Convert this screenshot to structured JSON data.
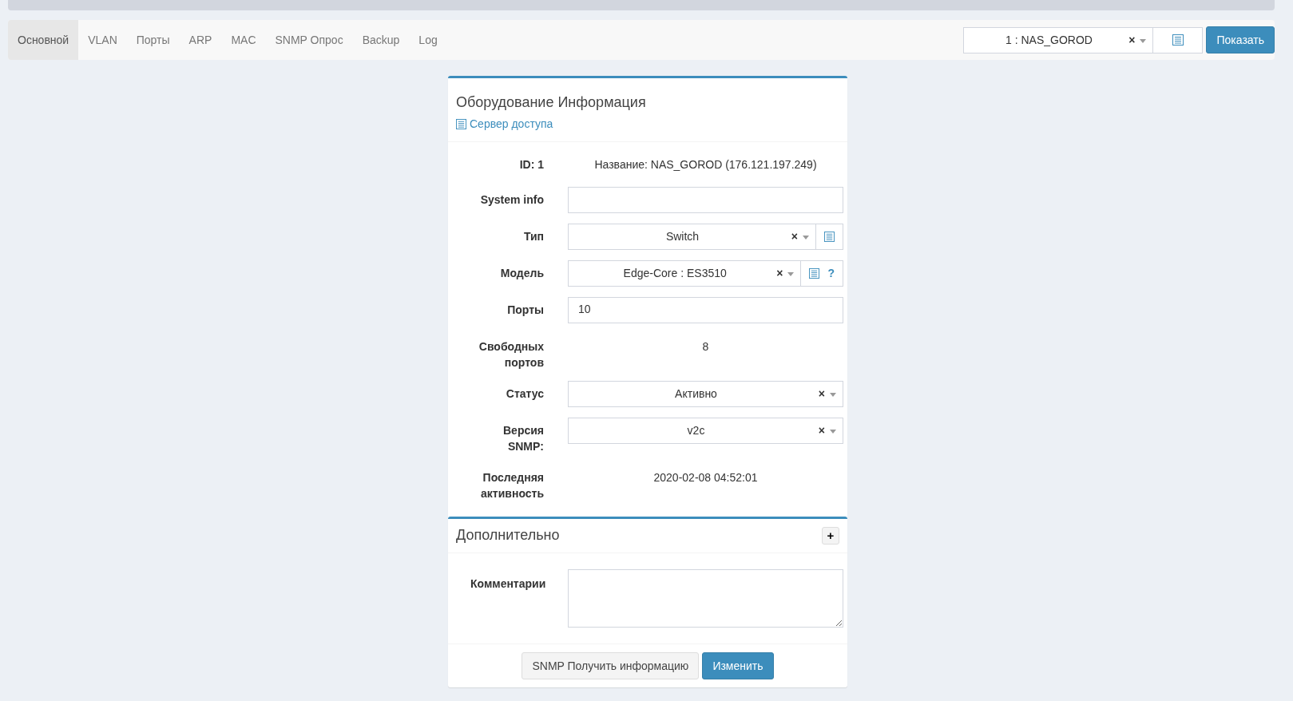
{
  "tabs": [
    {
      "label": "Основной",
      "selected": true
    },
    {
      "label": "VLAN",
      "selected": false
    },
    {
      "label": "Порты",
      "selected": false
    },
    {
      "label": "ARP",
      "selected": false
    },
    {
      "label": "MAC",
      "selected": false
    },
    {
      "label": "SNMP Опрос",
      "selected": false
    },
    {
      "label": "Backup",
      "selected": false
    },
    {
      "label": "Log",
      "selected": false
    }
  ],
  "device_picker": {
    "value": "1 : NAS_GOROD",
    "clear": "×",
    "button": "Показать"
  },
  "info_panel": {
    "title": "Оборудование Информация",
    "link": "Сервер доступа",
    "rows": [
      {
        "kind": "text",
        "label": "ID: 1",
        "value": "Название: NAS_GOROD (176.121.197.249)"
      },
      {
        "kind": "input",
        "label": "System info"
      },
      {
        "kind": "select",
        "label": "Тип",
        "value": "Switch",
        "clear": "×",
        "list_button": true
      },
      {
        "kind": "select",
        "label": "Модель",
        "value": "Edge-Core : ES3510",
        "clear": "×",
        "list_button": true,
        "help": "?"
      },
      {
        "kind": "input",
        "label": "Порты",
        "value": "10"
      },
      {
        "kind": "text",
        "label": "Свободных портов",
        "value": "8"
      },
      {
        "kind": "select",
        "label": "Статус",
        "value": "Активно",
        "clear": "×",
        "list_button": false
      },
      {
        "kind": "select",
        "label": "Версия SNMP:",
        "value": "v2c",
        "clear": "×",
        "list_button": false
      },
      {
        "kind": "text",
        "label": "Последняя активность",
        "value": "2020-02-08 04:52:01"
      }
    ]
  },
  "extra_panel": {
    "title": "Дополнительно",
    "toggle": "+",
    "comment_label": "Комментарии"
  },
  "buttons": [
    {
      "label": "SNMP Получить информацию",
      "kind": "default"
    },
    {
      "label": "Изменить",
      "kind": "primary"
    }
  ]
}
